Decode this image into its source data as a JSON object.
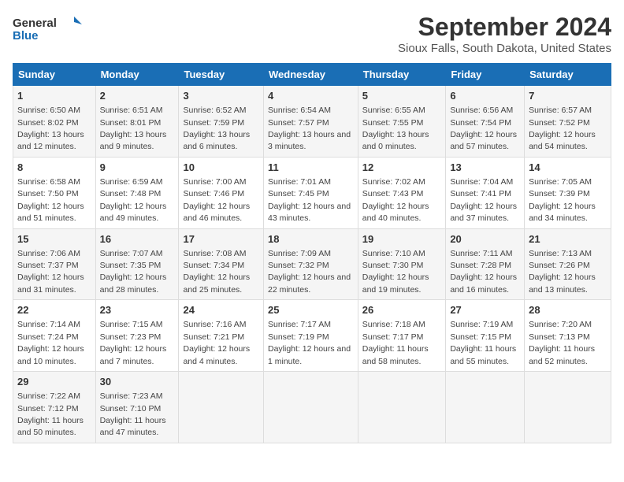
{
  "logo": {
    "line1": "General",
    "line2": "Blue"
  },
  "title": "September 2024",
  "subtitle": "Sioux Falls, South Dakota, United States",
  "days_of_week": [
    "Sunday",
    "Monday",
    "Tuesday",
    "Wednesday",
    "Thursday",
    "Friday",
    "Saturday"
  ],
  "weeks": [
    [
      {
        "day": "1",
        "sunrise": "6:50 AM",
        "sunset": "8:02 PM",
        "daylight": "13 hours and 12 minutes."
      },
      {
        "day": "2",
        "sunrise": "6:51 AM",
        "sunset": "8:01 PM",
        "daylight": "13 hours and 9 minutes."
      },
      {
        "day": "3",
        "sunrise": "6:52 AM",
        "sunset": "7:59 PM",
        "daylight": "13 hours and 6 minutes."
      },
      {
        "day": "4",
        "sunrise": "6:54 AM",
        "sunset": "7:57 PM",
        "daylight": "13 hours and 3 minutes."
      },
      {
        "day": "5",
        "sunrise": "6:55 AM",
        "sunset": "7:55 PM",
        "daylight": "13 hours and 0 minutes."
      },
      {
        "day": "6",
        "sunrise": "6:56 AM",
        "sunset": "7:54 PM",
        "daylight": "12 hours and 57 minutes."
      },
      {
        "day": "7",
        "sunrise": "6:57 AM",
        "sunset": "7:52 PM",
        "daylight": "12 hours and 54 minutes."
      }
    ],
    [
      {
        "day": "8",
        "sunrise": "6:58 AM",
        "sunset": "7:50 PM",
        "daylight": "12 hours and 51 minutes."
      },
      {
        "day": "9",
        "sunrise": "6:59 AM",
        "sunset": "7:48 PM",
        "daylight": "12 hours and 49 minutes."
      },
      {
        "day": "10",
        "sunrise": "7:00 AM",
        "sunset": "7:46 PM",
        "daylight": "12 hours and 46 minutes."
      },
      {
        "day": "11",
        "sunrise": "7:01 AM",
        "sunset": "7:45 PM",
        "daylight": "12 hours and 43 minutes."
      },
      {
        "day": "12",
        "sunrise": "7:02 AM",
        "sunset": "7:43 PM",
        "daylight": "12 hours and 40 minutes."
      },
      {
        "day": "13",
        "sunrise": "7:04 AM",
        "sunset": "7:41 PM",
        "daylight": "12 hours and 37 minutes."
      },
      {
        "day": "14",
        "sunrise": "7:05 AM",
        "sunset": "7:39 PM",
        "daylight": "12 hours and 34 minutes."
      }
    ],
    [
      {
        "day": "15",
        "sunrise": "7:06 AM",
        "sunset": "7:37 PM",
        "daylight": "12 hours and 31 minutes."
      },
      {
        "day": "16",
        "sunrise": "7:07 AM",
        "sunset": "7:35 PM",
        "daylight": "12 hours and 28 minutes."
      },
      {
        "day": "17",
        "sunrise": "7:08 AM",
        "sunset": "7:34 PM",
        "daylight": "12 hours and 25 minutes."
      },
      {
        "day": "18",
        "sunrise": "7:09 AM",
        "sunset": "7:32 PM",
        "daylight": "12 hours and 22 minutes."
      },
      {
        "day": "19",
        "sunrise": "7:10 AM",
        "sunset": "7:30 PM",
        "daylight": "12 hours and 19 minutes."
      },
      {
        "day": "20",
        "sunrise": "7:11 AM",
        "sunset": "7:28 PM",
        "daylight": "12 hours and 16 minutes."
      },
      {
        "day": "21",
        "sunrise": "7:13 AM",
        "sunset": "7:26 PM",
        "daylight": "12 hours and 13 minutes."
      }
    ],
    [
      {
        "day": "22",
        "sunrise": "7:14 AM",
        "sunset": "7:24 PM",
        "daylight": "12 hours and 10 minutes."
      },
      {
        "day": "23",
        "sunrise": "7:15 AM",
        "sunset": "7:23 PM",
        "daylight": "12 hours and 7 minutes."
      },
      {
        "day": "24",
        "sunrise": "7:16 AM",
        "sunset": "7:21 PM",
        "daylight": "12 hours and 4 minutes."
      },
      {
        "day": "25",
        "sunrise": "7:17 AM",
        "sunset": "7:19 PM",
        "daylight": "12 hours and 1 minute."
      },
      {
        "day": "26",
        "sunrise": "7:18 AM",
        "sunset": "7:17 PM",
        "daylight": "11 hours and 58 minutes."
      },
      {
        "day": "27",
        "sunrise": "7:19 AM",
        "sunset": "7:15 PM",
        "daylight": "11 hours and 55 minutes."
      },
      {
        "day": "28",
        "sunrise": "7:20 AM",
        "sunset": "7:13 PM",
        "daylight": "11 hours and 52 minutes."
      }
    ],
    [
      {
        "day": "29",
        "sunrise": "7:22 AM",
        "sunset": "7:12 PM",
        "daylight": "11 hours and 50 minutes."
      },
      {
        "day": "30",
        "sunrise": "7:23 AM",
        "sunset": "7:10 PM",
        "daylight": "11 hours and 47 minutes."
      },
      {
        "day": "",
        "sunrise": "",
        "sunset": "",
        "daylight": ""
      },
      {
        "day": "",
        "sunrise": "",
        "sunset": "",
        "daylight": ""
      },
      {
        "day": "",
        "sunrise": "",
        "sunset": "",
        "daylight": ""
      },
      {
        "day": "",
        "sunrise": "",
        "sunset": "",
        "daylight": ""
      },
      {
        "day": "",
        "sunrise": "",
        "sunset": "",
        "daylight": ""
      }
    ]
  ]
}
